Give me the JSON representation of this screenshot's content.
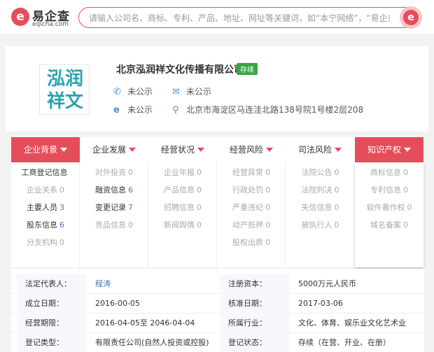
{
  "header": {
    "logo_glyph": "e",
    "logo_name": "易企查",
    "logo_sub": "eqicha.com",
    "search_placeholder": "请输入公司名、商标、专利、产品、地址、网址等关键词，如“本宁网络”，“易企查”",
    "search_glyph": "e"
  },
  "company": {
    "logo_text": "泓润祥文",
    "name": "北京泓润祥文化传播有限公司",
    "status": "存续",
    "phone": "未公示",
    "email": "未公示",
    "website": "未公示",
    "address": "北京市海淀区马连洼北路138号院1号楼2层208"
  },
  "tabs": [
    {
      "label": "企业背景"
    },
    {
      "label": "企业发展"
    },
    {
      "label": "经营状况"
    },
    {
      "label": "经营风险"
    },
    {
      "label": "司法风险"
    },
    {
      "label": "知识产权"
    }
  ],
  "menu": [
    [
      {
        "label": "工商登记信息",
        "count": ""
      },
      {
        "label": "企业关系",
        "count": "0"
      },
      {
        "label": "主要人员",
        "count": "3"
      },
      {
        "label": "股东信息",
        "count": "6"
      },
      {
        "label": "分支机构",
        "count": "0"
      }
    ],
    [
      {
        "label": "对外投资",
        "count": "0"
      },
      {
        "label": "融资信息",
        "count": "6"
      },
      {
        "label": "变更记录",
        "count": "7"
      },
      {
        "label": "竞品信息",
        "count": "0"
      }
    ],
    [
      {
        "label": "企业年报",
        "count": "0"
      },
      {
        "label": "产品信息",
        "count": "0"
      },
      {
        "label": "招聘信息",
        "count": "0"
      },
      {
        "label": "新闻舆情",
        "count": "0"
      }
    ],
    [
      {
        "label": "经营异常",
        "count": "0"
      },
      {
        "label": "行政处罚",
        "count": "0"
      },
      {
        "label": "严重违纪",
        "count": "0"
      },
      {
        "label": "动产抵押",
        "count": "0"
      },
      {
        "label": "股权出质",
        "count": "0"
      }
    ],
    [
      {
        "label": "法院公告",
        "count": "0"
      },
      {
        "label": "法院判决",
        "count": "0"
      },
      {
        "label": "失信信息",
        "count": "0"
      },
      {
        "label": "被执行人",
        "count": "0"
      }
    ],
    [
      {
        "label": "商标信息",
        "count": "0"
      },
      {
        "label": "专利信息",
        "count": "0"
      },
      {
        "label": "软件著作权",
        "count": "0"
      },
      {
        "label": "域名备案",
        "count": "0"
      }
    ]
  ],
  "details": [
    {
      "l1": "法定代表人：",
      "v1": "程涛",
      "l2": "注册资本：",
      "v2": "5000万元人民币"
    },
    {
      "l1": "成立日期：",
      "v1": "2016-00-05",
      "l2": "核准日期：",
      "v2": "2017-03-06"
    },
    {
      "l1": "经营期限：",
      "v1": "2016-04-05至 2046-04-04",
      "l2": "所属行业：",
      "v2": "文化、体育、娱乐业文化艺术业"
    },
    {
      "l1": "登记类型：",
      "v1": "有限责任公司(自然人投资或控股)",
      "l2": "登记状态：",
      "v2": "存续（在营、开业、在册）"
    }
  ],
  "colors": {
    "accent": "#e64d5b",
    "status_green": "#37a543",
    "link": "#4a78c2",
    "logo_teal": "#2aa3b0"
  },
  "icons": {
    "phone": "phone-icon",
    "email": "mail-icon",
    "website": "ie-icon",
    "address": "location-pin-icon"
  }
}
